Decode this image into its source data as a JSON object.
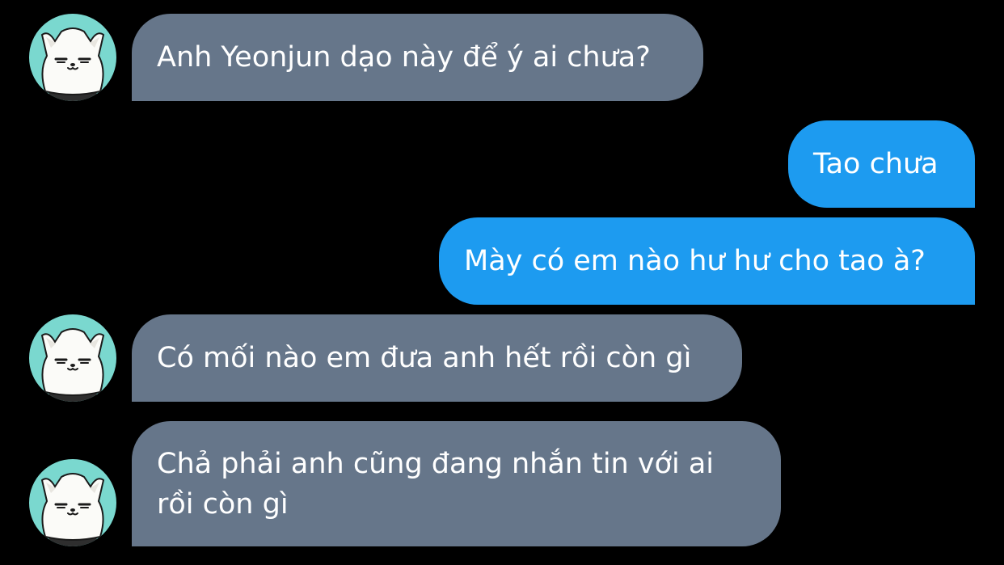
{
  "conversation": {
    "messages": [
      {
        "side": "received",
        "text": "Anh Yeonjun dạo này để ý ai chưa?",
        "avatar": "white-cat-avatar"
      },
      {
        "side": "sent",
        "text": "Tao chưa"
      },
      {
        "side": "sent",
        "text": "Mày có em nào hư hư cho tao à?"
      },
      {
        "side": "received",
        "text": "Có mối nào em đưa anh hết rồi còn gì",
        "avatar": "white-cat-avatar"
      },
      {
        "side": "received",
        "text": "Chả phải anh cũng đang nhắn tin với ai rồi còn gì",
        "avatar": "white-cat-avatar"
      }
    ]
  },
  "colors": {
    "background": "#000000",
    "received_bubble": "#66768a",
    "sent_bubble": "#1d9bf0",
    "avatar_bg": "#7ad8cf"
  }
}
